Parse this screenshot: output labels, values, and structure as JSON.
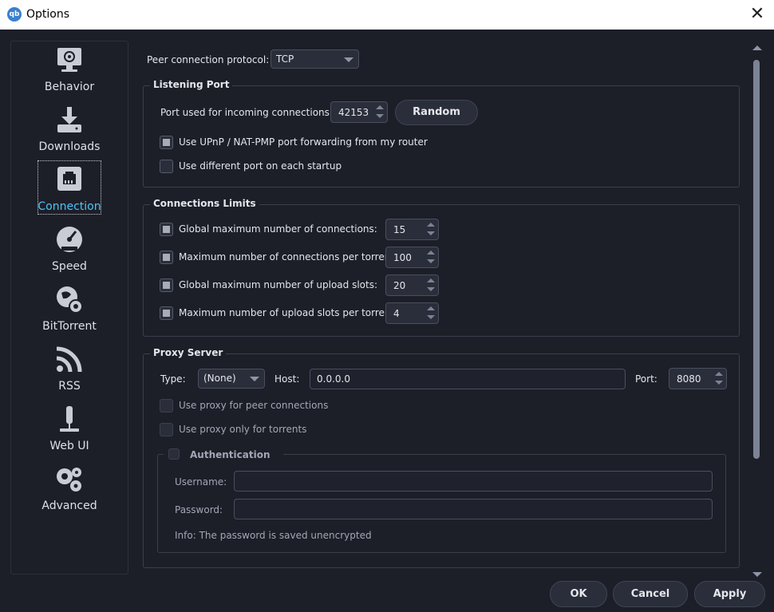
{
  "window": {
    "title": "Options",
    "app_icon_text": "qb",
    "close_symbol": "✕"
  },
  "sidebar": {
    "items": [
      {
        "label": "Behavior",
        "icon": "gear-monitor-icon"
      },
      {
        "label": "Downloads",
        "icon": "download-icon"
      },
      {
        "label": "Connection",
        "icon": "network-port-icon",
        "active": true
      },
      {
        "label": "Speed",
        "icon": "speedometer-icon"
      },
      {
        "label": "BitTorrent",
        "icon": "globe-gear-icon"
      },
      {
        "label": "RSS",
        "icon": "rss-icon"
      },
      {
        "label": "Web UI",
        "icon": "web-ui-icon"
      },
      {
        "label": "Advanced",
        "icon": "gears-icon"
      }
    ]
  },
  "protocol": {
    "label": "Peer connection protocol:",
    "value": "TCP"
  },
  "listening_port": {
    "title": "Listening Port",
    "port_label": "Port used for incoming connections:",
    "port_value": "42153",
    "random_label": "Random",
    "upnp_label": "Use UPnP / NAT-PMP port forwarding from my router",
    "upnp_checked": true,
    "different_port_label": "Use different port on each startup",
    "different_port_checked": false
  },
  "connection_limits": {
    "title": "Connections Limits",
    "rows": [
      {
        "label": "Global maximum number of connections:",
        "value": "15"
      },
      {
        "label": "Maximum number of connections per torrent:",
        "value": "100"
      },
      {
        "label": "Global maximum number of upload slots:",
        "value": "20"
      },
      {
        "label": "Maximum number of upload slots per torrent:",
        "value": "4"
      }
    ]
  },
  "proxy": {
    "title": "Proxy Server",
    "type_label": "Type:",
    "type_value": "(None)",
    "host_label": "Host:",
    "host_value": "0.0.0.0",
    "port_label": "Port:",
    "port_value": "8080",
    "peer_label": "Use proxy for peer connections",
    "torrents_label": "Use proxy only for torrents",
    "auth": {
      "title": "Authentication",
      "username_label": "Username:",
      "password_label": "Password:",
      "info": "Info: The password is saved unencrypted"
    }
  },
  "buttons": {
    "ok": "OK",
    "cancel": "Cancel",
    "apply": "Apply"
  }
}
